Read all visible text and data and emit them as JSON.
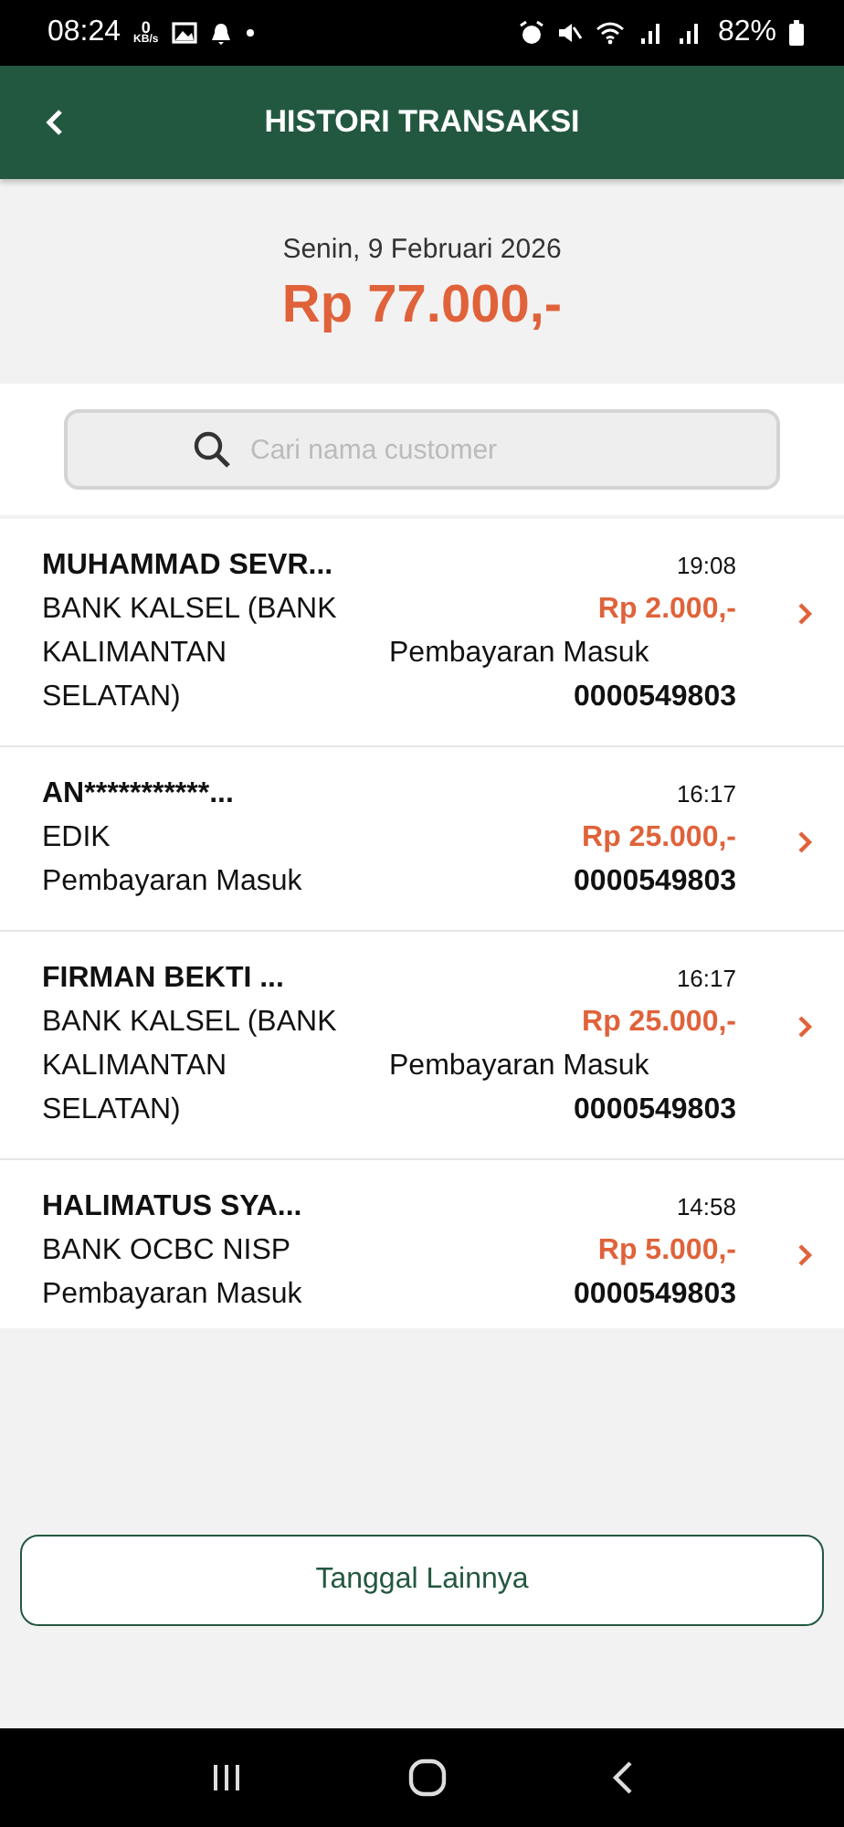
{
  "status_bar": {
    "time": "08:24",
    "speed_value": "0",
    "speed_unit": "KB/s",
    "battery": "82%"
  },
  "header": {
    "title": "HISTORI TRANSAKSI"
  },
  "summary": {
    "date": "Senin, 9 Februari 2026",
    "total": "Rp 77.000,-"
  },
  "search": {
    "placeholder": "Cari nama customer"
  },
  "transactions": [
    {
      "name": "MUHAMMAD SEVR...",
      "bank_lines": [
        "BANK KALSEL (BANK",
        "KALIMANTAN",
        "SELATAN)"
      ],
      "type": "Pembayaran Masuk",
      "time": "19:08",
      "amount": "Rp 2.000,-",
      "account": "0000549803"
    },
    {
      "name": "AN***********...",
      "bank_lines": [
        "EDIK"
      ],
      "type": "Pembayaran Masuk",
      "time": "16:17",
      "amount": "Rp 25.000,-",
      "account": "0000549803"
    },
    {
      "name": "FIRMAN BEKTI ...",
      "bank_lines": [
        "BANK KALSEL (BANK",
        "KALIMANTAN",
        "SELATAN)"
      ],
      "type": "Pembayaran Masuk",
      "time": "16:17",
      "amount": "Rp 25.000,-",
      "account": "0000549803"
    },
    {
      "name": "HALIMATUS SYA...",
      "bank_lines": [
        "BANK OCBC NISP"
      ],
      "type": "Pembayaran Masuk",
      "time": "14:58",
      "amount": "Rp 5.000,-",
      "account": "0000549803"
    }
  ],
  "more_button": "Tanggal Lainnya"
}
